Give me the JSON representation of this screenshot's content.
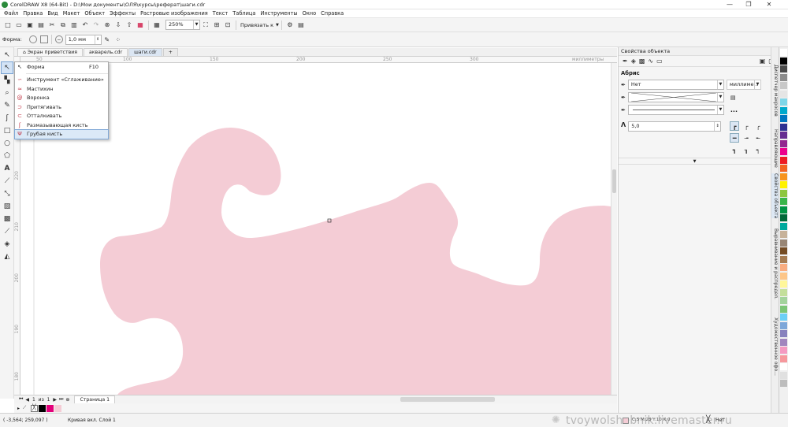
{
  "titlebar": {
    "title": "CorelDRAW X8 (64-Bit) - D:\\Мои документы\\ОЛЯ\\курсы\\реферат\\шаги.cdr",
    "minimize": "—",
    "maximize": "❐",
    "close": "✕"
  },
  "menu": [
    "Файл",
    "Правка",
    "Вид",
    "Макет",
    "Объект",
    "Эффекты",
    "Растровые изображения",
    "Текст",
    "Таблица",
    "Инструменты",
    "Окно",
    "Справка"
  ],
  "std_toolbar": {
    "zoom": "250%",
    "snap_label": "Привязать к"
  },
  "property_bar": {
    "label": "Форма:",
    "width": "1,0 мм"
  },
  "tabs": {
    "welcome": "Экран приветствия",
    "doc1": "акварель.cdr",
    "doc2": "шаги.cdr",
    "add": "+"
  },
  "ruler": {
    "units": "миллиметры",
    "hticks": [
      "50",
      "100",
      "150",
      "200",
      "250",
      "300"
    ],
    "vticks": [
      "230",
      "220",
      "210",
      "200",
      "190",
      "180"
    ]
  },
  "flyout": {
    "items": [
      {
        "label": "Форма",
        "shortcut": "F10",
        "icon": "shape-tool-icon",
        "glyph": "↖"
      },
      {
        "label": "Инструмент «Сглаживание»",
        "icon": "smooth-tool-icon",
        "glyph": "∽"
      },
      {
        "label": "Мастихин",
        "icon": "smear-tool-icon",
        "glyph": "≈"
      },
      {
        "label": "Воронка",
        "icon": "twirl-tool-icon",
        "glyph": "@"
      },
      {
        "label": "Притягивать",
        "icon": "attract-tool-icon",
        "glyph": "⊃"
      },
      {
        "label": "Отталкивать",
        "icon": "repel-tool-icon",
        "glyph": "⊂"
      },
      {
        "label": "Размазывающая кисть",
        "icon": "smudge-brush-icon",
        "glyph": "ʃ"
      },
      {
        "label": "Грубая кисть",
        "icon": "roughen-brush-icon",
        "glyph": "Ψ"
      }
    ]
  },
  "docker": {
    "title": "Свойства объекта",
    "section": "Абрис",
    "outline_width": "Нет",
    "units": "миллиме...",
    "miter": "5,0",
    "more": "..."
  },
  "docker_tabs": [
    "Диспетчер макросов",
    "Направляющие",
    "Свойства объекта",
    "Выравнивание и распредел.",
    "Художественное офо..."
  ],
  "pagebar": {
    "page_info": "1  из  1",
    "page_tab": "Страница 1"
  },
  "statusbar": {
    "coords": "( -3,564; 259,097 )",
    "info": "Кривая вкл. Слой 1",
    "fill_info": "C:5 M:28 Y:10 K:0",
    "outline_info": "Нет"
  },
  "watermark": "tvoywolshebnik.livemaster.ru",
  "colors": {
    "shape_fill": "#f4ccd5",
    "accent": "#2a7ad0"
  },
  "palette": [
    "#ffffff",
    "#000000",
    "#4a4a4a",
    "#8c8c8c",
    "#c8c8c8",
    "#e5e5e5",
    "#7fd6e8",
    "#00a9cc",
    "#0076c0",
    "#2e3192",
    "#662d91",
    "#92278f",
    "#ec008c",
    "#ed1c24",
    "#f26522",
    "#f7941d",
    "#fff200",
    "#8dc63f",
    "#39b54a",
    "#009444",
    "#006838",
    "#00a99d",
    "#c7b299",
    "#998675",
    "#754c24",
    "#a67c52",
    "#f9ad81",
    "#fdc689",
    "#fff799",
    "#c4df9b",
    "#a3d39c",
    "#7cc576",
    "#6dcff6",
    "#7da7d9",
    "#8781bd",
    "#a186be",
    "#f49ac1",
    "#f6989d",
    "#ffffff",
    "#e0e0e0",
    "#bdbdbd"
  ]
}
